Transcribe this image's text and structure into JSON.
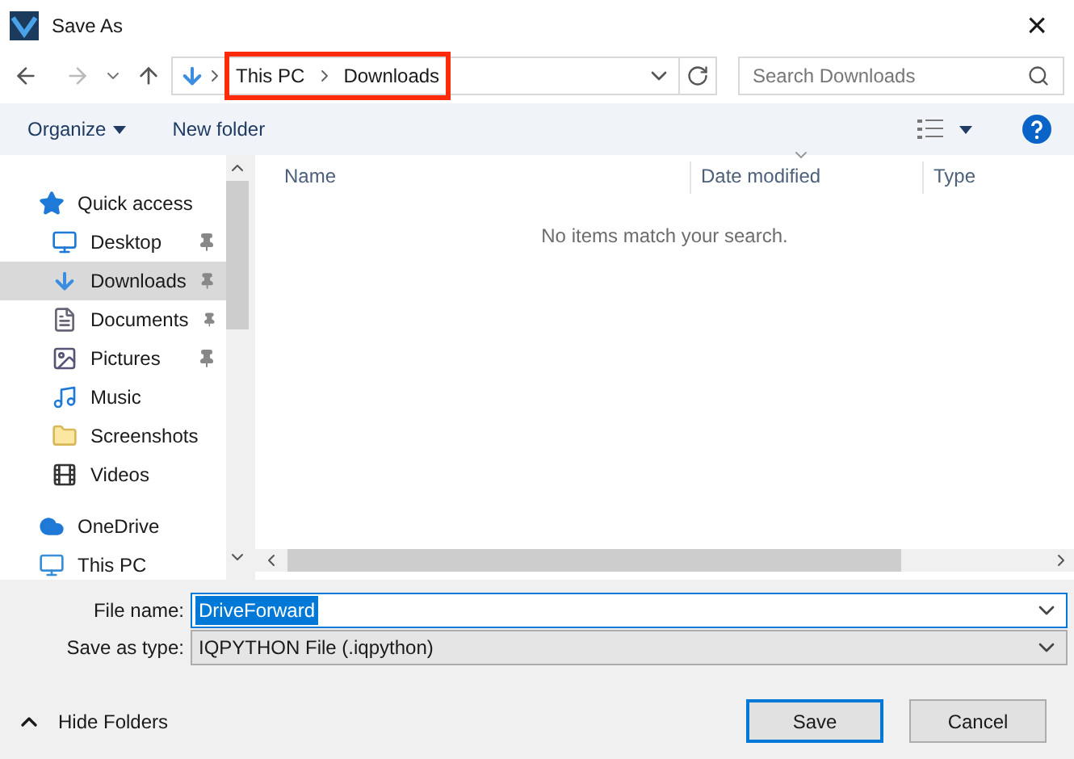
{
  "window": {
    "title": "Save As",
    "close": "×"
  },
  "address_bar": {
    "crumbs": [
      "This PC",
      "Downloads"
    ],
    "highlighted": true
  },
  "search": {
    "placeholder": "Search Downloads"
  },
  "toolbar": {
    "organize": "Organize",
    "new_folder": "New folder"
  },
  "sidebar": {
    "items": [
      {
        "label": "Quick access",
        "kind": "quick",
        "selected": false,
        "pinned": false
      },
      {
        "label": "Desktop",
        "kind": "desktop",
        "selected": false,
        "pinned": true
      },
      {
        "label": "Downloads",
        "kind": "downloads",
        "selected": true,
        "pinned": true
      },
      {
        "label": "Documents",
        "kind": "documents",
        "selected": false,
        "pinned": true
      },
      {
        "label": "Pictures",
        "kind": "pictures",
        "selected": false,
        "pinned": true
      },
      {
        "label": "Music",
        "kind": "music",
        "selected": false,
        "pinned": false
      },
      {
        "label": "Screenshots",
        "kind": "folder",
        "selected": false,
        "pinned": false
      },
      {
        "label": "Videos",
        "kind": "videos",
        "selected": false,
        "pinned": false
      },
      {
        "label": "OneDrive",
        "kind": "cloud",
        "selected": false,
        "pinned": false
      },
      {
        "label": "This PC",
        "kind": "pc",
        "selected": false,
        "pinned": false
      }
    ]
  },
  "table": {
    "columns": [
      "Name",
      "Date modified",
      "Type"
    ],
    "empty_message": "No items match your search."
  },
  "form": {
    "file_name_label": "File name:",
    "file_name": "DriveForward",
    "type_label": "Save as type:",
    "type_value": "IQPYTHON File (.iqpython)"
  },
  "footer": {
    "hide_folders": "Hide Folders",
    "buttons": [
      {
        "label": "Save",
        "default": true
      },
      {
        "label": "Cancel",
        "default": false
      }
    ]
  }
}
